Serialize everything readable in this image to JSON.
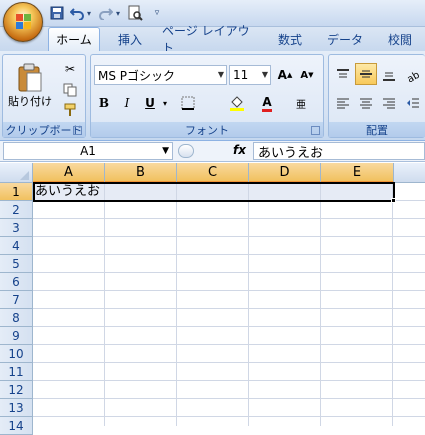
{
  "quick_access": {
    "save_icon": "save-icon",
    "undo_icon": "undo-icon",
    "redo_icon": "redo-icon",
    "print_icon": "print-preview-icon"
  },
  "tabs": [
    "ホーム",
    "挿入",
    "ページ レイアウト",
    "数式",
    "データ",
    "校閲"
  ],
  "ribbon": {
    "clipboard": {
      "paste_label": "貼り付け",
      "group_label": "クリップボード"
    },
    "font": {
      "font_name": "MS Pゴシック",
      "font_size": "11",
      "group_label": "フォント",
      "bold": "B",
      "italic": "I",
      "underline": "U",
      "font_color": "A"
    },
    "alignment": {
      "group_label": "配置"
    }
  },
  "formula_bar": {
    "name_box": "A1",
    "fx_label": "fx",
    "content": "あいうえお"
  },
  "grid": {
    "columns": [
      "A",
      "B",
      "C",
      "D",
      "E"
    ],
    "rows": [
      "1",
      "2",
      "3",
      "4",
      "5",
      "6",
      "7",
      "8",
      "9",
      "10",
      "11",
      "12",
      "13",
      "14"
    ],
    "cells": {
      "A1": "あいうえお"
    },
    "selection": "A1:E1"
  },
  "colors": {
    "accent": "#15428b",
    "active_header": "#f1c15f",
    "ribbon_bg": "#dbe6f4"
  }
}
